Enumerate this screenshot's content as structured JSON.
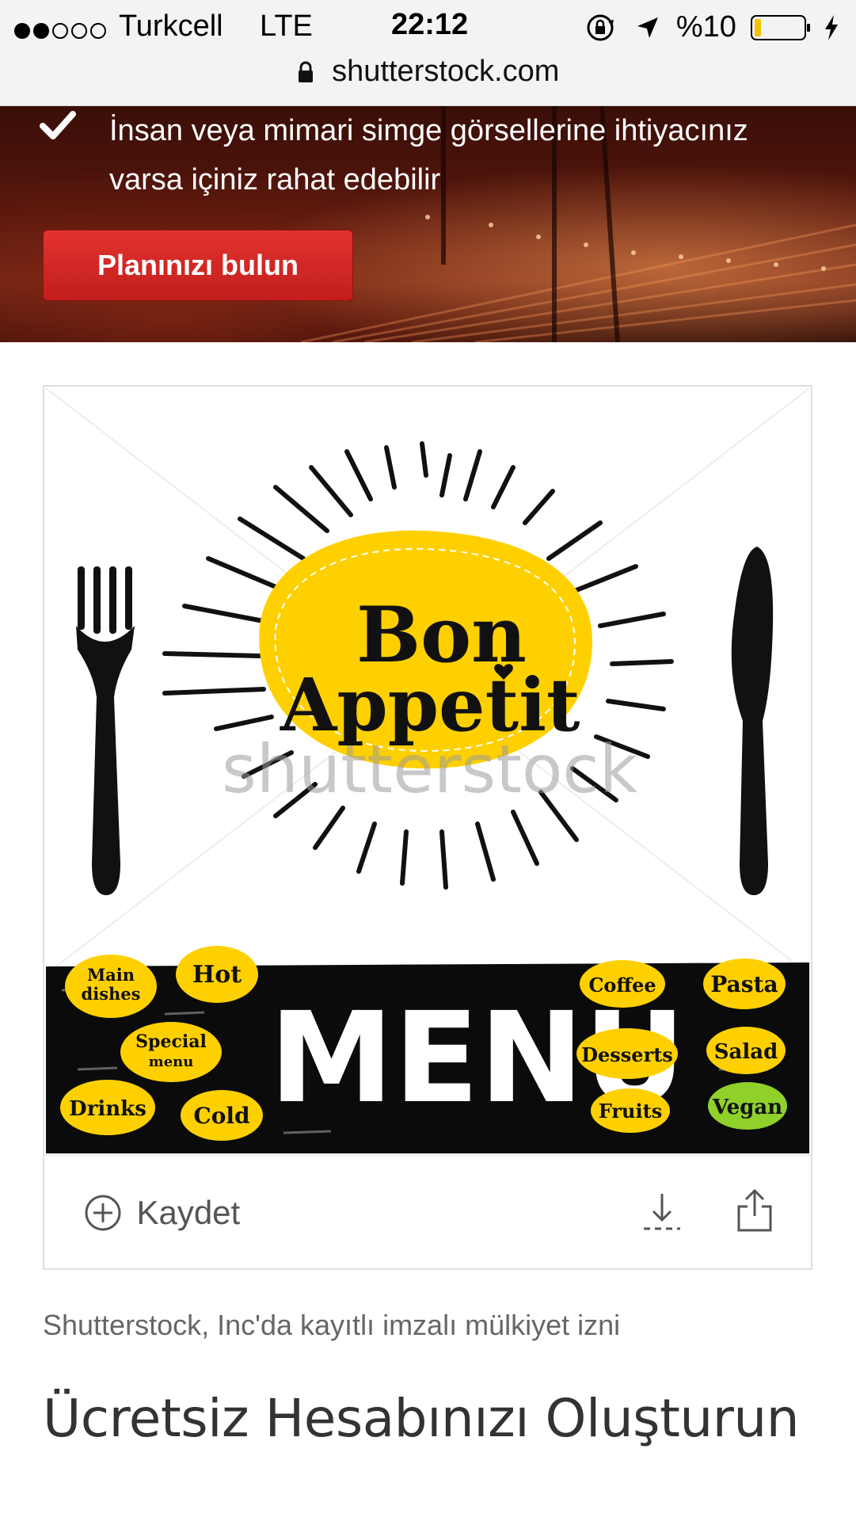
{
  "status_bar": {
    "carrier": "Turkcell",
    "network": "LTE",
    "time": "22:12",
    "battery_percent": "%10",
    "battery_level": 0.1
  },
  "browser": {
    "url": "shutterstock.com"
  },
  "hero": {
    "feature_text": "İnsan veya mimari simge görsellerine ihtiyacınız varsa içiniz rahat edebilir",
    "cta_label": "Planınızı bulun",
    "colors": {
      "cta": "#d42a26"
    }
  },
  "image": {
    "headline_line1": "Bon",
    "headline_line2": "Appetit",
    "watermark": "shutterstock",
    "menu_word": "MENU",
    "menu_items_left": [
      "Main dishes",
      "Hot",
      "Special menu",
      "Drinks",
      "Cold"
    ],
    "menu_items_right": [
      "Coffee",
      "Pasta",
      "Desserts",
      "Salad",
      "Fruits",
      "Vegan"
    ]
  },
  "actions": {
    "save_label": "Kaydet"
  },
  "license_text": "Shutterstock, Inc'da kayıtlı imzalı mülkiyet izni",
  "create_account_title": "Ücretsiz Hesabınızı Oluşturun"
}
